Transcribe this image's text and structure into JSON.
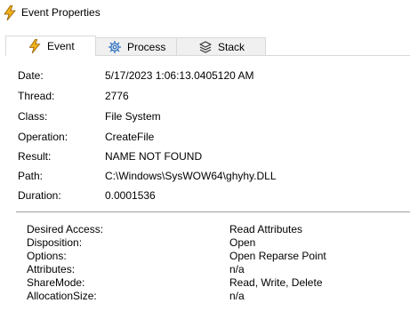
{
  "window": {
    "title": "Event Properties"
  },
  "tabs": [
    {
      "label": "Event",
      "icon": "lightning-icon"
    },
    {
      "label": "Process",
      "icon": "gear-icon"
    },
    {
      "label": "Stack",
      "icon": "stack-icon"
    }
  ],
  "properties": [
    {
      "label": "Date:",
      "value": "5/17/2023 1:06:13.0405120 AM"
    },
    {
      "label": "Thread:",
      "value": "2776"
    },
    {
      "label": "Class:",
      "value": "File System"
    },
    {
      "label": "Operation:",
      "value": "CreateFile"
    },
    {
      "label": "Result:",
      "value": "NAME NOT FOUND"
    },
    {
      "label": "Path:",
      "value": "C:\\Windows\\SysWOW64\\ghyhy.DLL"
    },
    {
      "label": "Duration:",
      "value": "0.0001536"
    }
  ],
  "details": [
    {
      "label": "Desired Access:",
      "value": "Read Attributes"
    },
    {
      "label": "Disposition:",
      "value": "Open"
    },
    {
      "label": "Options:",
      "value": "Open Reparse Point"
    },
    {
      "label": "Attributes:",
      "value": "n/a"
    },
    {
      "label": "ShareMode:",
      "value": "Read, Write, Delete"
    },
    {
      "label": "AllocationSize:",
      "value": "n/a"
    }
  ],
  "colors": {
    "lightning": "#f2b21a",
    "lightning_outline": "#8a5a00",
    "gear": "#3a78c2",
    "stack": "#333333"
  }
}
